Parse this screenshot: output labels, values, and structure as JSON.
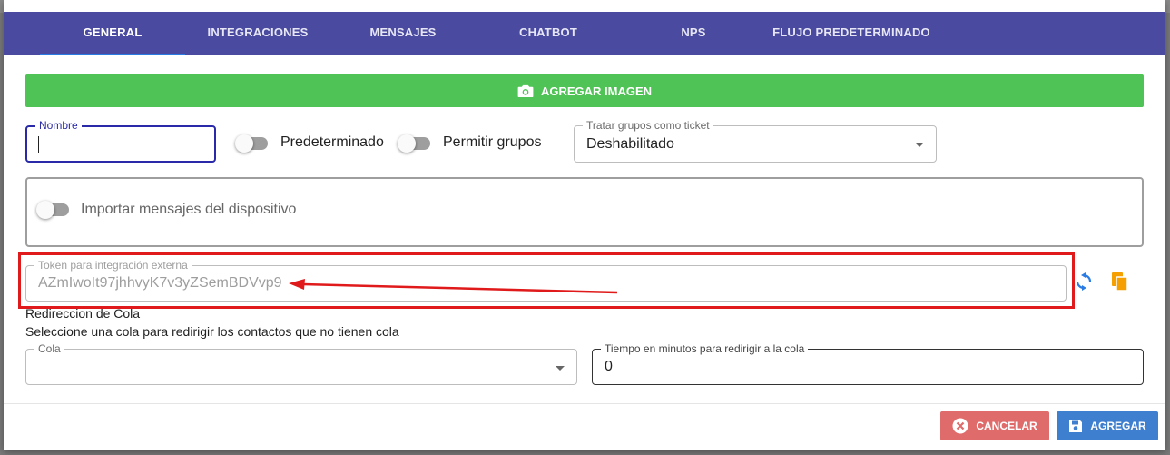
{
  "tabs": [
    {
      "label": "GENERAL",
      "active": true
    },
    {
      "label": "INTEGRACIONES",
      "active": false
    },
    {
      "label": "MENSAJES",
      "active": false
    },
    {
      "label": "CHATBOT",
      "active": false
    },
    {
      "label": "NPS",
      "active": false
    },
    {
      "label": "FLUJO PREDETERMINADO",
      "active": false
    }
  ],
  "add_image_button": {
    "label": "AGREGAR IMAGEN",
    "icon": "camera-icon"
  },
  "name_field": {
    "label": "Nombre",
    "value": ""
  },
  "toggles": {
    "predeterminado": {
      "label": "Predeterminado",
      "checked": false
    },
    "permitir_grupos": {
      "label": "Permitir grupos",
      "checked": false
    },
    "importar": {
      "label": "Importar mensajes del dispositivo",
      "checked": false
    }
  },
  "groups_select": {
    "label": "Tratar grupos como ticket",
    "value": "Deshabilitado"
  },
  "token_field": {
    "label": "Token para integración externa",
    "value": "AZmIwoIt97jhhvyK7v3yZSemBDVvp9"
  },
  "token_actions": {
    "refresh_icon": "refresh-icon",
    "copy_icon": "copy-icon"
  },
  "redirect": {
    "title": "Redireccion de Cola",
    "subtitle": "Seleccione una cola para redirigir los contactos que no tienen cola",
    "queue_label": "Cola",
    "queue_value": "",
    "time_label": "Tiempo en minutos para redirigir a la cola",
    "time_value": "0"
  },
  "footer": {
    "cancel_label": "CANCELAR",
    "save_label": "AGREGAR"
  },
  "colors": {
    "tab_bar": "#4a4aa0",
    "add_image": "#4fc355",
    "cancel": "#e06b6b",
    "save": "#3f7fcf",
    "annotation": "#e01a1a"
  }
}
